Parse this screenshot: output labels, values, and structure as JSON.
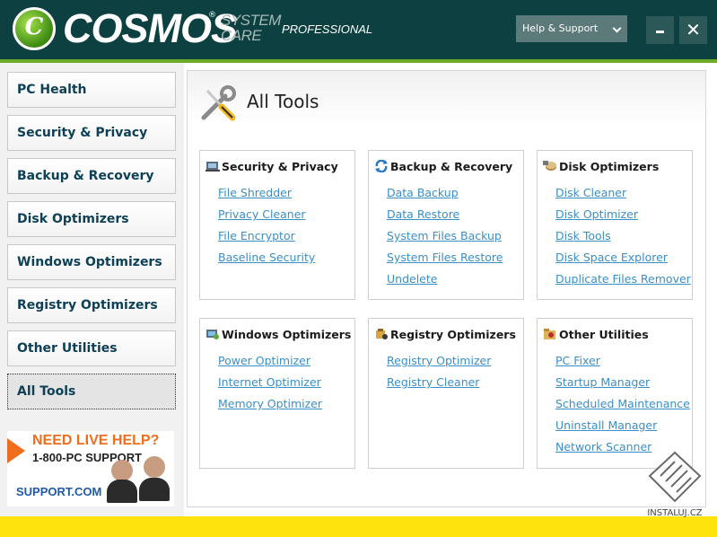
{
  "header": {
    "logo_letter": "C",
    "brand": "COSMOS",
    "brand_mark": "®",
    "product_line1": "SYSTEM",
    "product_line2": "CARE",
    "edition": "PROFESSIONAL",
    "help_label": "Help & Support",
    "minimize_icon": "minimize-icon",
    "close_glyph": "✕",
    "colors": {
      "header_bg": "#0d4141",
      "accent_green": "#6dab25",
      "help_btn_bg": "#5c7a7a"
    }
  },
  "sidebar": {
    "items": [
      {
        "label": "PC Health"
      },
      {
        "label": "Security & Privacy"
      },
      {
        "label": "Backup & Recovery"
      },
      {
        "label": "Disk Optimizers"
      },
      {
        "label": "Windows Optimizers"
      },
      {
        "label": "Registry Optimizers"
      },
      {
        "label": "Other Utilities"
      },
      {
        "label": "All Tools",
        "active": true
      }
    ]
  },
  "promo": {
    "line1": "NEED LIVE HELP?",
    "line2": "1-800-PC SUPPORT",
    "line3": "SUPPORT.COM"
  },
  "main": {
    "title": "All Tools",
    "link_color": "#3a8fc8",
    "cards": [
      {
        "title": "Security & Privacy",
        "icon": "security-icon",
        "links": [
          "File Shredder",
          "Privacy Cleaner",
          "File Encryptor",
          "Baseline Security"
        ]
      },
      {
        "title": "Backup & Recovery",
        "icon": "backup-icon",
        "links": [
          "Data Backup",
          "Data Restore",
          "System Files Backup",
          "System Files Restore",
          "Undelete"
        ]
      },
      {
        "title": "Disk Optimizers",
        "icon": "disk-icon",
        "links": [
          "Disk Cleaner",
          "Disk Optimizer",
          "Disk Tools",
          "Disk Space Explorer",
          "Duplicate Files Remover"
        ]
      },
      {
        "title": "Windows Optimizers",
        "icon": "windows-icon",
        "links": [
          "Power Optimizer",
          "Internet Optimizer",
          "Memory Optimizer"
        ]
      },
      {
        "title": "Registry Optimizers",
        "icon": "registry-icon",
        "links": [
          "Registry Optimizer",
          "Registry Cleaner"
        ]
      },
      {
        "title": "Other Utilities",
        "icon": "utilities-icon",
        "links": [
          "PC Fixer",
          "Startup Manager",
          "Scheduled Maintenance",
          "Uninstall Manager",
          "Network Scanner"
        ]
      }
    ]
  },
  "watermark": {
    "text": "INSTALUJ.CZ"
  },
  "footer": {
    "color": "#ffe30b"
  }
}
